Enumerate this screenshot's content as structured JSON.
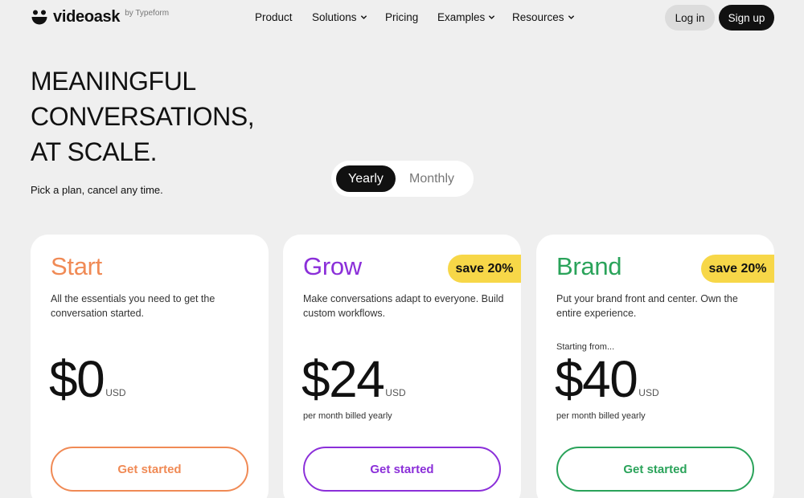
{
  "header": {
    "logo": {
      "name": "videoask",
      "by": "by Typeform"
    },
    "nav": [
      {
        "label": "Product",
        "dropdown": false
      },
      {
        "label": "Solutions",
        "dropdown": true
      },
      {
        "label": "Pricing",
        "dropdown": false
      },
      {
        "label": "Examples",
        "dropdown": true
      },
      {
        "label": "Resources",
        "dropdown": true
      }
    ],
    "login_label": "Log in",
    "signup_label": "Sign up"
  },
  "hero": {
    "title_lines": [
      "MEANINGFUL",
      "CONVERSATIONS,",
      "AT SCALE."
    ],
    "subtitle": "Pick a plan, cancel any time."
  },
  "billing_toggle": {
    "options": [
      "Yearly",
      "Monthly"
    ],
    "selected": "Yearly"
  },
  "plans": [
    {
      "name": "Start",
      "badge": "",
      "description": "All the essentials you need to get the conversation started.",
      "starting_from": "",
      "price": "$0",
      "currency": "USD",
      "price_note": "",
      "cta": "Get started",
      "color": "#f08a55"
    },
    {
      "name": "Grow",
      "badge": "save 20%",
      "description": "Make conversations adapt to everyone. Build custom workflows.",
      "starting_from": "",
      "price": "$24",
      "currency": "USD",
      "price_note": "per month billed yearly",
      "cta": "Get started",
      "color": "#8b2fd9"
    },
    {
      "name": "Brand",
      "badge": "save 20%",
      "description": "Put your brand front and center. Own the entire experience.",
      "starting_from": "Starting from...",
      "price": "$40",
      "currency": "USD",
      "price_note": "per month billed yearly",
      "cta": "Get started",
      "color": "#2aa35a"
    }
  ],
  "colors": {
    "background": "#efefef",
    "badge": "#f7d748",
    "dark": "#111111"
  }
}
